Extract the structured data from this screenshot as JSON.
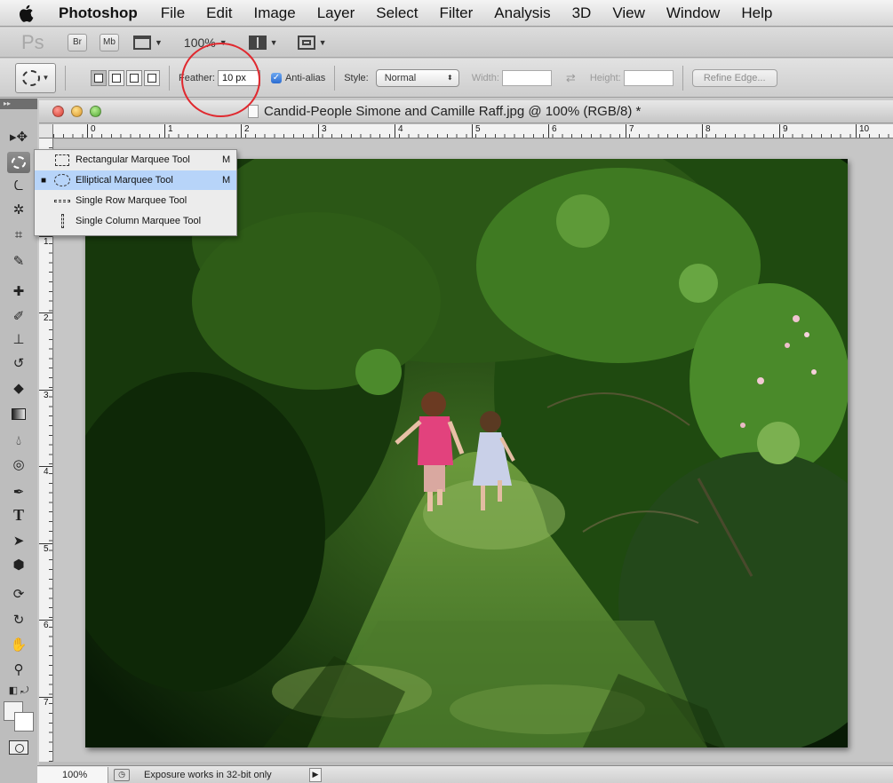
{
  "menubar": {
    "app": "Photoshop",
    "items": [
      "File",
      "Edit",
      "Image",
      "Layer",
      "Select",
      "Filter",
      "Analysis",
      "3D",
      "View",
      "Window",
      "Help"
    ]
  },
  "appbar": {
    "logo": "Ps",
    "bridge": "Br",
    "minibridge": "Mb",
    "zoom": "100%"
  },
  "options": {
    "feather_label": "Feather:",
    "feather_value": "10 px",
    "antialias_label": "Anti-alias",
    "antialias_checked": true,
    "style_label": "Style:",
    "style_value": "Normal",
    "width_label": "Width:",
    "height_label": "Height:",
    "refine_edge": "Refine Edge..."
  },
  "document": {
    "title": "Candid-People Simone and Camille Raff.jpg @ 100% (RGB/8) *",
    "hruler": [
      "0",
      "1",
      "2",
      "3",
      "4",
      "5",
      "6",
      "7",
      "8",
      "9",
      "10"
    ],
    "vruler": [
      "1",
      "2",
      "3",
      "4",
      "5",
      "6",
      "7"
    ]
  },
  "flyout": {
    "items": [
      {
        "label": "Rectangular Marquee Tool",
        "shortcut": "M",
        "icon": "rect-marquee-icon",
        "selected": false
      },
      {
        "label": "Elliptical Marquee Tool",
        "shortcut": "M",
        "icon": "ellipse-marquee-icon",
        "selected": true
      },
      {
        "label": "Single Row Marquee Tool",
        "shortcut": "",
        "icon": "row-marquee-icon",
        "selected": false
      },
      {
        "label": "Single Column Marquee Tool",
        "shortcut": "",
        "icon": "column-marquee-icon",
        "selected": false
      }
    ]
  },
  "status": {
    "zoom": "100%",
    "message": "Exposure works in 32-bit only"
  },
  "colors": {
    "highlight_circle": "#e0292f",
    "selection": "#b7d4f9"
  }
}
